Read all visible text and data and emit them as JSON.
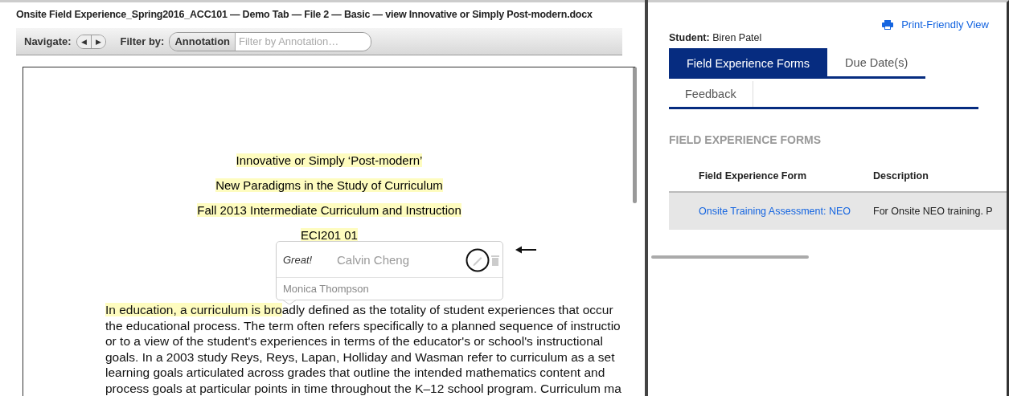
{
  "window": {
    "title": "Onsite Field Experience_Spring2016_ACC101 —  Demo Tab —  File 2 —  Basic —  view Innovative or Simply Post-modern.docx"
  },
  "toolbar": {
    "navigate_label": "Navigate:",
    "nav_prev": "◀",
    "nav_next": "▶",
    "filter_label": "Filter by:",
    "filter_mode": "Annotation",
    "filter_placeholder": "Filter by Annotation…"
  },
  "document": {
    "headings": [
      "Innovative or Simply ‘Post-modern’",
      "New Paradigms in the Study of Curriculum",
      "Fall 2013 Intermediate Curriculum and Instruction",
      "ECI201 01"
    ],
    "ghost_text": "Calvin Cheng",
    "paragraph": [
      {
        "highlight": " In education, a curriculum is bro",
        "text": "adly defined as the totality of student experiences that occur"
      },
      {
        "text": "the educational process. The term often refers specifically to a planned sequence of instructio"
      },
      {
        "text": "or to a view of the student's experiences in terms of the educator's or school's instructional"
      },
      {
        "text": "goals. In a 2003 study Reys, Reys, Lapan, Holliday and Wasman refer to curriculum as a set"
      },
      {
        "text": "learning goals articulated across grades that outline the intended mathematics content and"
      },
      {
        "text": "process goals at particular points in time throughout the K–12 school program. Curriculum ma"
      }
    ],
    "annotation": {
      "comment": "Great!",
      "author": "Monica Thompson",
      "edit_circled": true
    }
  },
  "panel": {
    "print_link": "Print-Friendly View",
    "student_label": "Student:",
    "student_name": "Biren Patel",
    "tabs": [
      {
        "label": "Field Experience Forms",
        "selected": true
      },
      {
        "label": "Due Date(s)",
        "selected": false
      },
      {
        "label": "Feedback",
        "selected": false
      }
    ],
    "section_title": "FIELD EXPERIENCE FORMS",
    "table": {
      "columns": [
        "Field Experience Form",
        "Description"
      ],
      "rows": [
        {
          "form": "Onsite Training Assessment: NEO",
          "description": "For Onsite NEO training. P"
        }
      ]
    }
  }
}
